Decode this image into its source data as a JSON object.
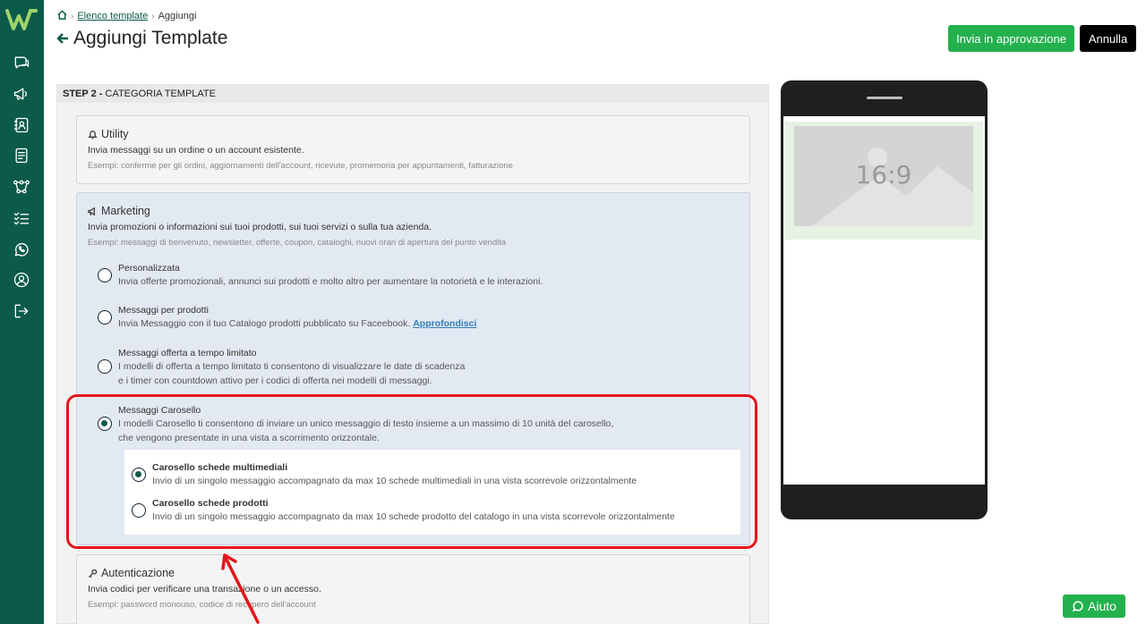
{
  "header": {
    "breadcrumb": {
      "link": "Elenco template",
      "current": "Aggiungi"
    },
    "title": "Aggiungi Template",
    "approve_label": "Invia in approvazione",
    "cancel_label": "Annulla"
  },
  "step": {
    "label": "STEP 2 -",
    "name": "CATEGORIA TEMPLATE"
  },
  "categories": {
    "utility": {
      "title": "Utility",
      "description": "Invia messaggi su un ordine o un account esistente.",
      "examples": "Esempi: conferme per gli ordini, aggiornamenti dell'account, ricevute, promemoria per appuntamenti, fatturazione"
    },
    "marketing": {
      "title": "Marketing",
      "description": "Invia promozioni o informazioni sui tuoi prodotti, sui tuoi servizi o sulla tua azienda.",
      "examples": "Esempi: messaggi di benvenuto, newsletter, offerte, coupon, cataloghi, nuovi orari di apertura del punto vendita",
      "options": [
        {
          "title": "Personalizzata",
          "desc": "Invia offerte promozionali, annunci sui prodotti e molto altro per aumentare la notorietà e le interazioni.",
          "checked": false
        },
        {
          "title": "Messaggi per prodotti",
          "desc": "Invia Messaggio con il tuo Catalogo prodotti pubblicato su Faceebook.",
          "link": "Approfondisci",
          "checked": false
        },
        {
          "title": "Messaggi offerta a tempo limitato",
          "desc": "I modelli di offerta a tempo limitato ti consentono di visualizzare le date di scadenza",
          "desc2": "e i timer con countdown attivo per i codici di offerta nei modelli di messaggi.",
          "checked": false
        },
        {
          "title": "Messaggi Carosello",
          "desc": "I modelli Carosello ti consentono di inviare un unico messaggio di testo insieme a un massimo di 10 unità del carosello,",
          "desc2": "che vengono presentate in una vista a scorrimento orizzontale.",
          "checked": true
        }
      ],
      "carousel_options": [
        {
          "title": "Carosello schede multimediali",
          "desc": "Invio di un singolo messaggio accompagnato da max 10 schede multimediali in una vista scorrevole orizzontalmente",
          "checked": true
        },
        {
          "title": "Carosello schede prodotti",
          "desc": "Invio di un singolo messaggio accompagnato da max 10 schede prodotto del catalogo in una vista scorrevole orizzontalmente",
          "checked": false
        }
      ]
    },
    "auth": {
      "title": "Autenticazione",
      "description": "Invia codici per verificare una transazione o un accesso.",
      "examples": "Esempi: password monouso, codice di recupero dell'account"
    }
  },
  "preview": {
    "ratio_label": "16:9"
  },
  "help": {
    "label": "Aiuto"
  },
  "colors": {
    "brand": "#0b5a4a",
    "accent_green": "#23b14d",
    "highlight": "#e5141a"
  }
}
